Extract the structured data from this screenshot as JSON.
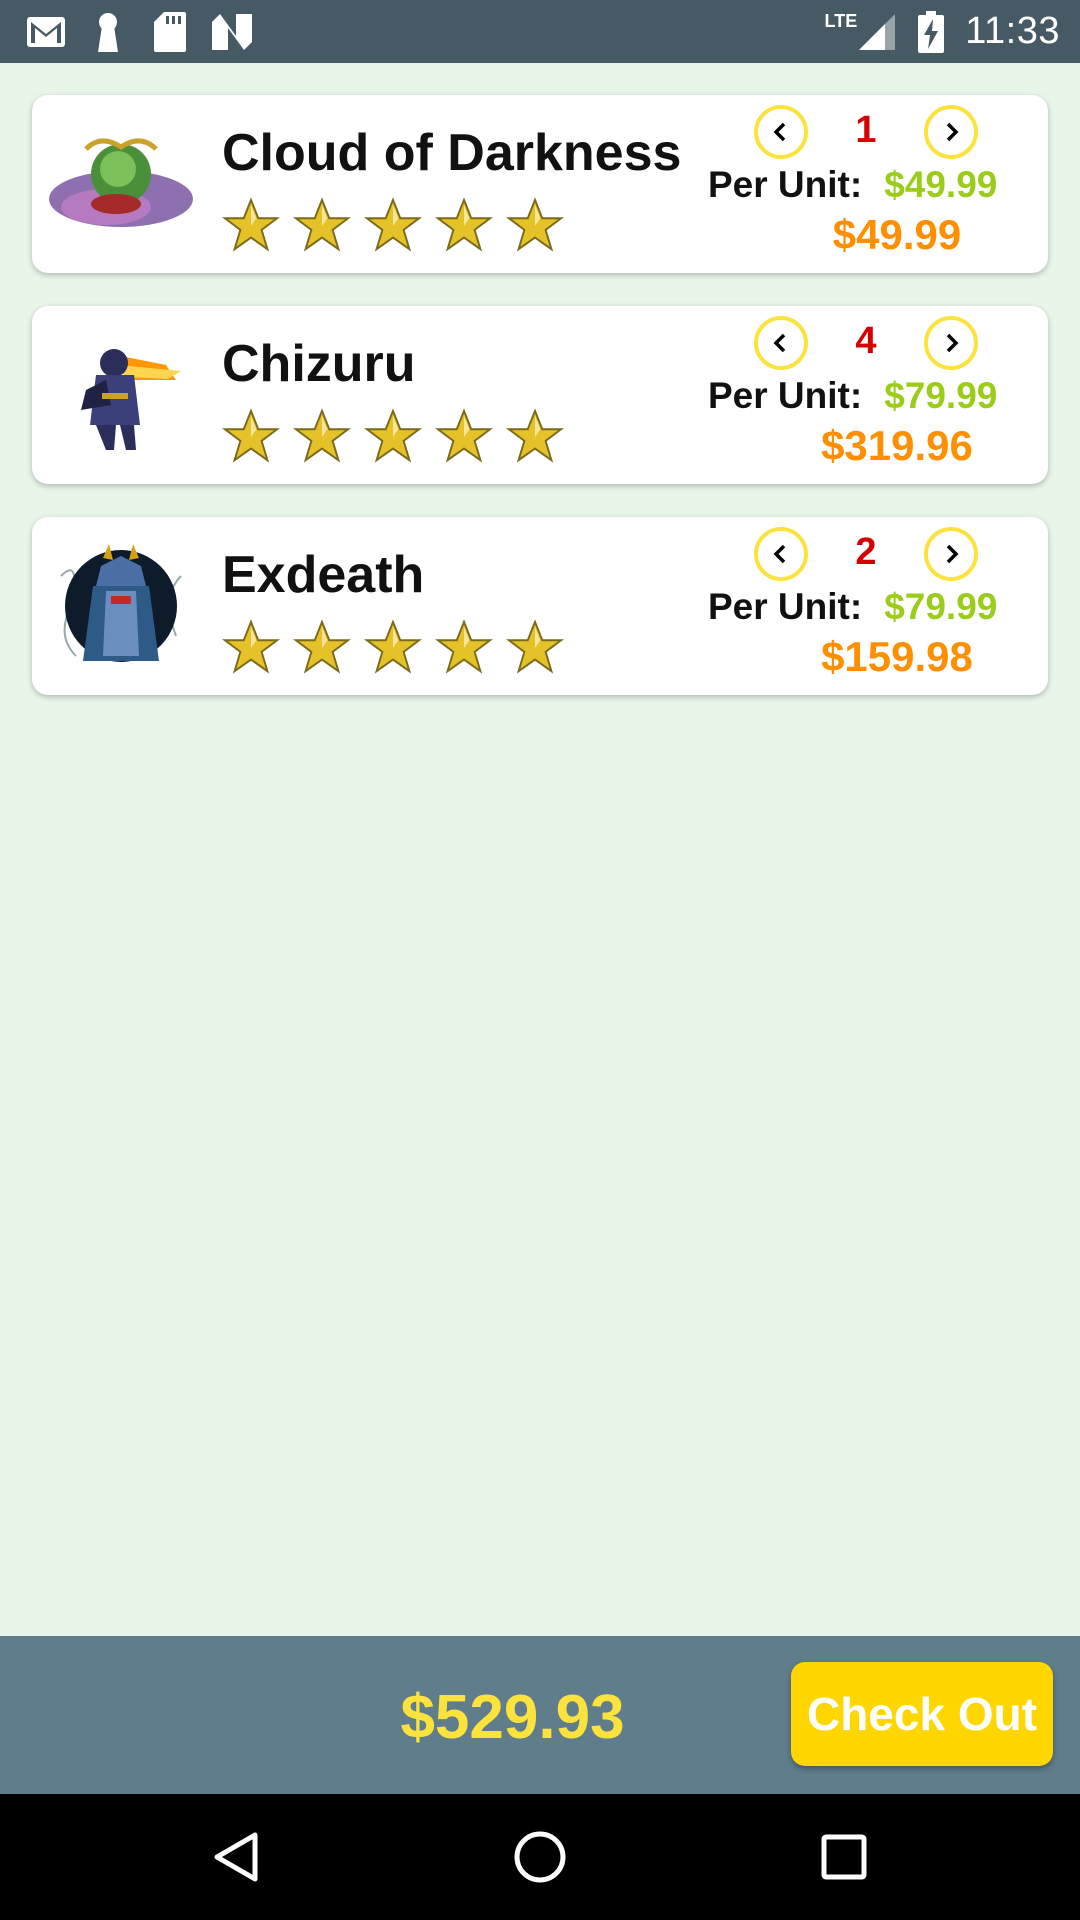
{
  "status_bar": {
    "time": "11:33",
    "network": "LTE",
    "left_icons": [
      "gmail-icon",
      "keyhole-icon",
      "sd-card-icon",
      "n-logo-icon"
    ],
    "right_icons": [
      "signal-icon",
      "battery-charging-icon"
    ]
  },
  "cart": {
    "per_unit_label": "Per Unit:",
    "items": [
      {
        "name": "Cloud of Darkness",
        "rating": 5,
        "quantity": "1",
        "unit_price": "$49.99",
        "total": "$49.99",
        "thumb_icon": "cloud-of-darkness-sprite"
      },
      {
        "name": "Chizuru",
        "rating": 5,
        "quantity": "4",
        "unit_price": "$79.99",
        "total": "$319.96",
        "thumb_icon": "chizuru-sprite"
      },
      {
        "name": "Exdeath",
        "rating": 5,
        "quantity": "2",
        "unit_price": "$79.99",
        "total": "$159.98",
        "thumb_icon": "exdeath-sprite"
      }
    ]
  },
  "bottom_bar": {
    "grand_total": "$529.93",
    "checkout_label": "Check Out"
  },
  "nav_bar": {
    "buttons": [
      "back-icon",
      "home-icon",
      "recents-icon"
    ]
  },
  "colors": {
    "status_bar": "#455a64",
    "background": "#e8f5e9",
    "quantity": "#d50000",
    "unit_price": "#9bcc1a",
    "item_total": "#ff8f00",
    "grand_total": "#fce23c",
    "checkout": "#ffd600",
    "bottom_bar": "#607d8b"
  }
}
